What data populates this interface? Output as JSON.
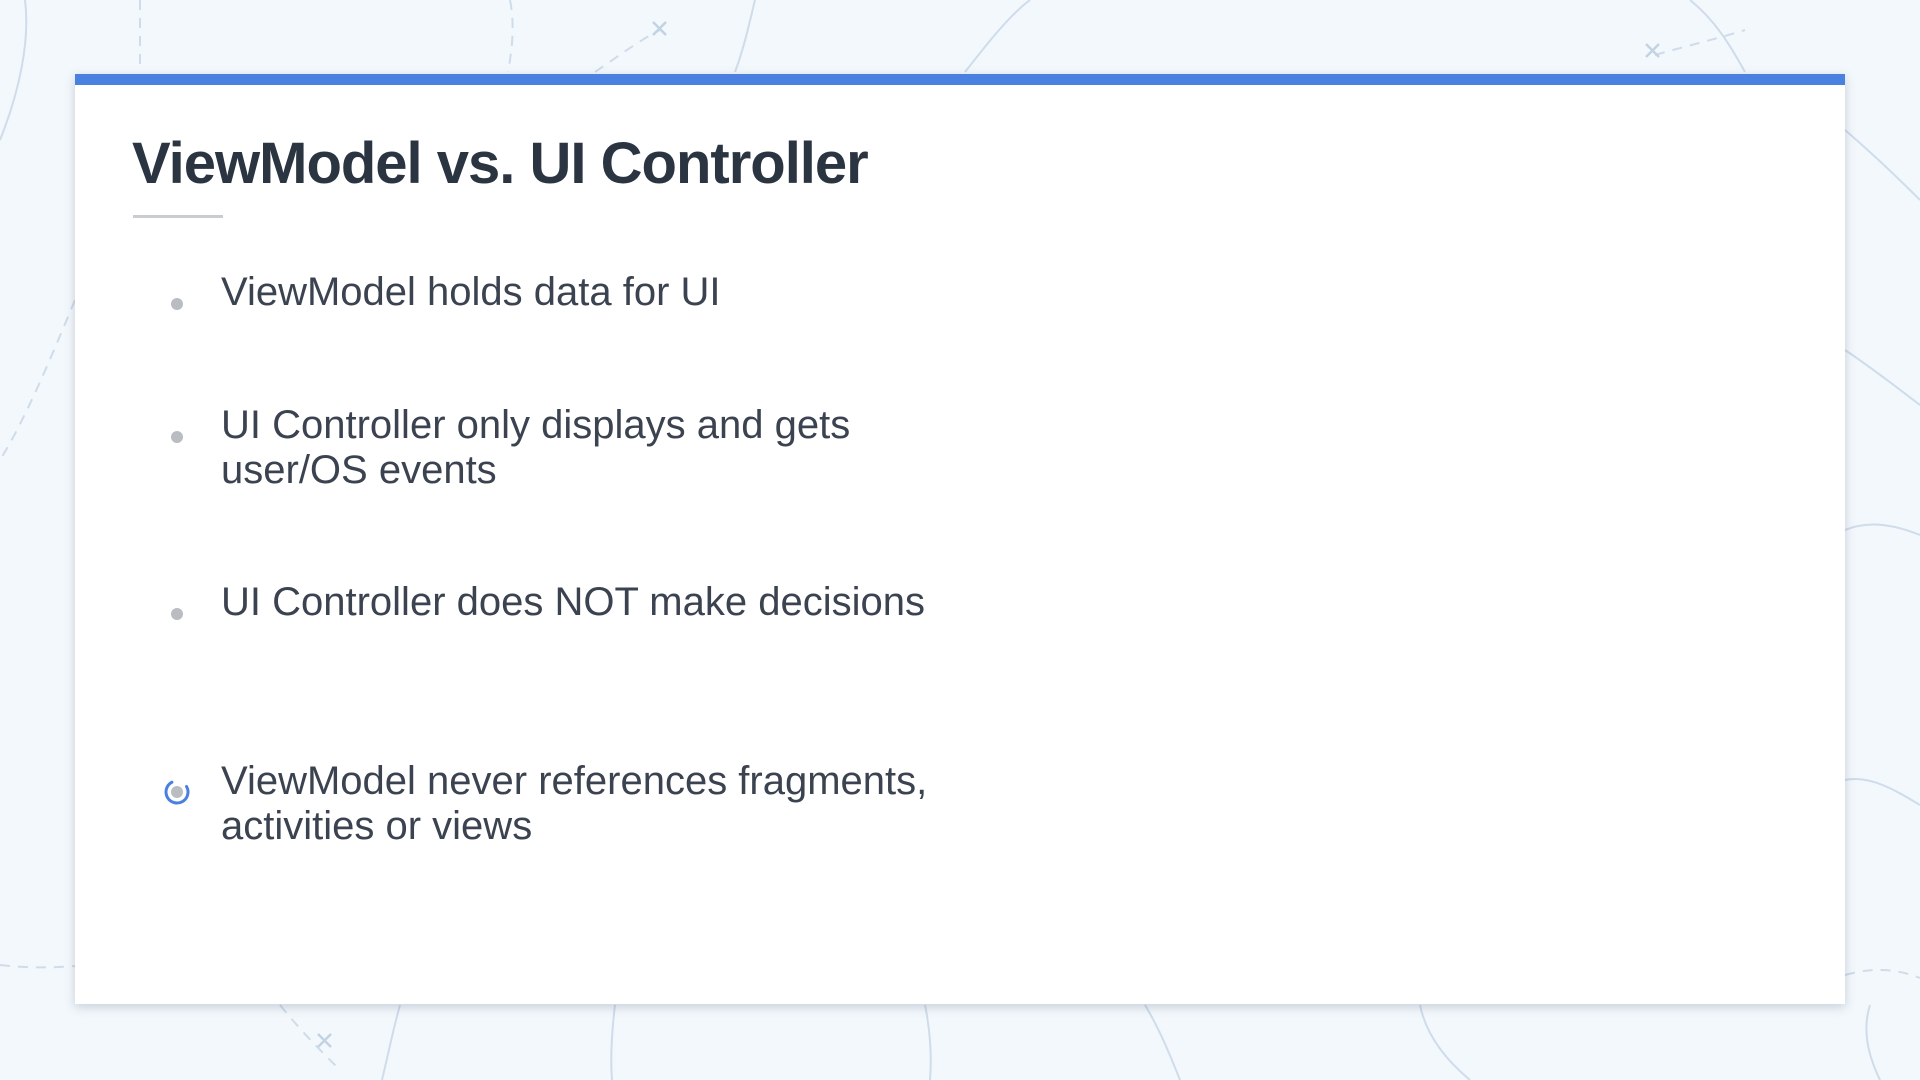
{
  "slide": {
    "title": "ViewModel vs. UI Controller",
    "bullets": [
      {
        "text": "ViewModel holds data for UI",
        "active": false
      },
      {
        "text": "UI Controller only displays and gets user/OS events",
        "active": false
      },
      {
        "text": "UI Controller does NOT make decisions",
        "active": false
      },
      {
        "text": "ViewModel never references fragments, activities or views",
        "active": true
      }
    ]
  },
  "colors": {
    "accent": "#4a80e0",
    "background": "#f3f8fc",
    "card": "#ffffff",
    "title_text": "#2b3441",
    "body_text": "#3c4350",
    "bullet": "#b9bdc2"
  },
  "icons": {
    "bullet": "bullet-dot-icon",
    "active_bullet": "loading-spinner-icon"
  }
}
